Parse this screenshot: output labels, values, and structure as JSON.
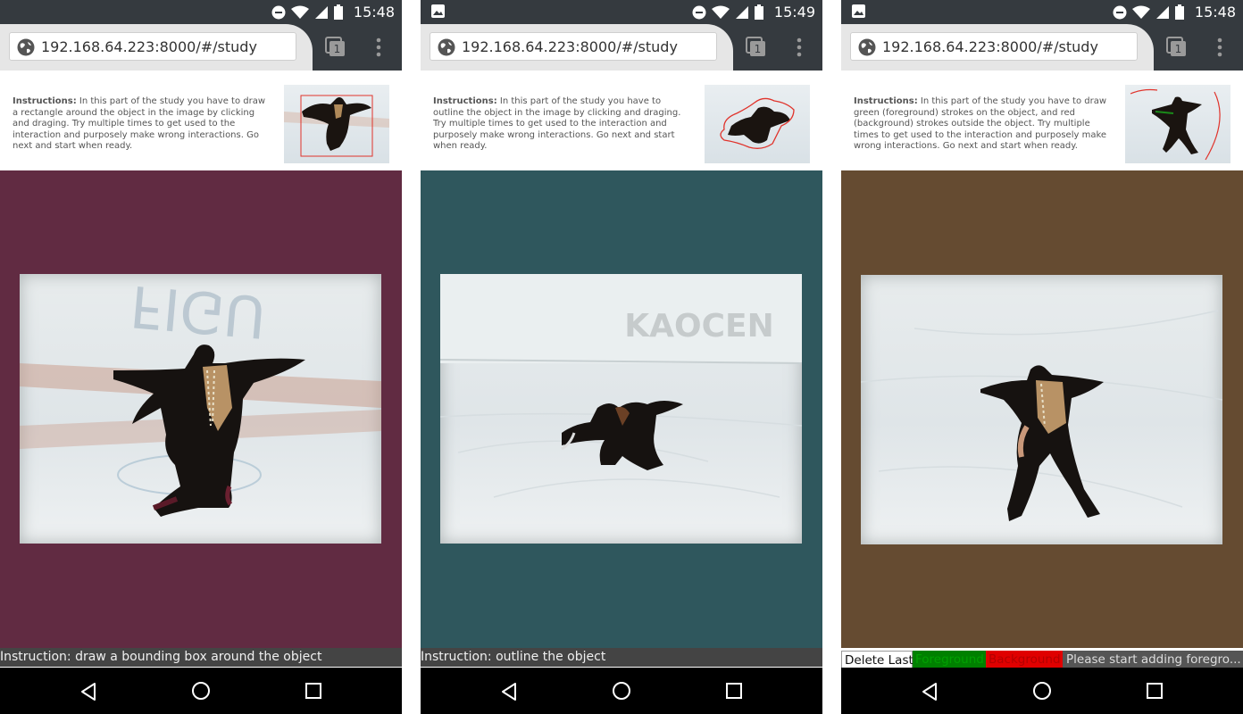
{
  "screens": [
    {
      "status_time": "15:48",
      "show_notification_icon": false,
      "url": "192.168.64.223:8000/#/study",
      "tab_count": "1",
      "instructions_label": "Instructions:",
      "instructions_body": " In this part of the study you have to draw a rectangle around the object in the image by clicking and draging. Try multiple times to get used to the interaction and purposely make wrong interactions. Go next and start when ready.",
      "bottom_instruction": "Instruction: draw a bounding box around the object",
      "canvas_color": "#612b42"
    },
    {
      "status_time": "15:49",
      "show_notification_icon": true,
      "url": "192.168.64.223:8000/#/study",
      "tab_count": "1",
      "instructions_label": "Instructions:",
      "instructions_body": " In this part of the study you have to outline the object in the image by clicking and draging. Try multiple times to get used to the interaction and purposely make wrong interactions. Go next and start when ready.",
      "bottom_instruction": "Instruction: outline the object",
      "canvas_color": "#2f575d"
    },
    {
      "status_time": "15:48",
      "show_notification_icon": true,
      "url": "192.168.64.223:8000/#/study",
      "tab_count": "1",
      "instructions_label": "Instructions:",
      "instructions_body": " In this part of the study you have to draw green (foreground) strokes on the object, and red (background) strokes outside the object. Try multiple times to get used to the interaction and purposely make wrong interactions. Go next and start when ready.",
      "controls": {
        "delete_label": "Delete Last",
        "foreground_label": "Foreground",
        "background_label": "Background",
        "status_message": "Please start adding foregro..."
      },
      "canvas_color": "#654b31"
    }
  ],
  "icons": {
    "globe": "globe-icon",
    "tabs": "tabs-switcher-icon",
    "menu": "overflow-menu-icon",
    "back": "back-nav-icon",
    "home": "home-nav-icon",
    "recent": "recent-apps-icon"
  },
  "colors": {
    "status_bar": "#353a3f",
    "bottom_bar": "#444444",
    "foreground": "#008000",
    "background": "#e00000"
  }
}
